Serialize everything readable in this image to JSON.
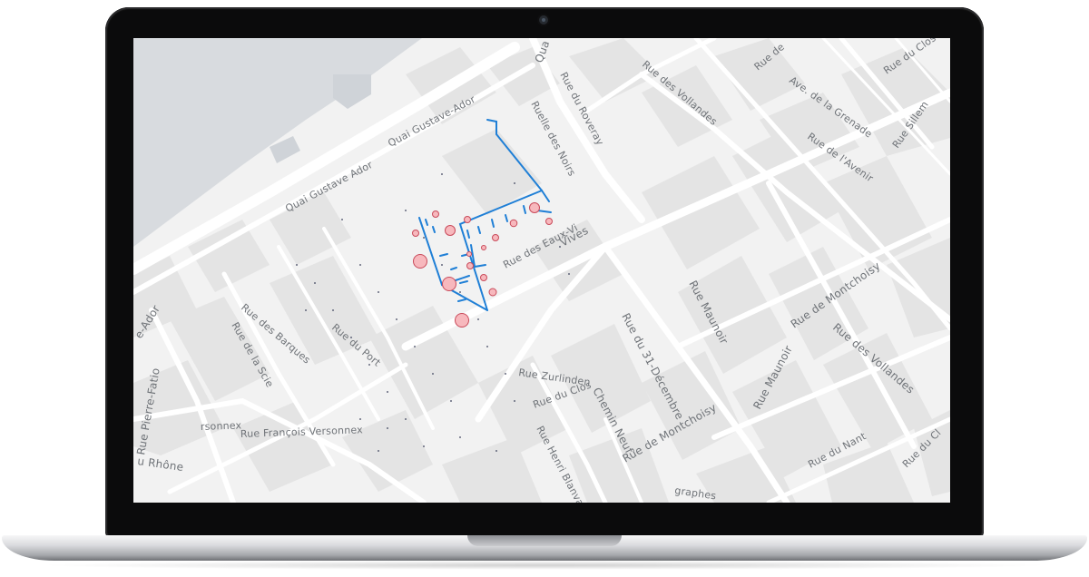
{
  "map": {
    "street_labels": [
      {
        "id": "quai-gustave-ador-1",
        "text": "Quai Gustave Ador"
      },
      {
        "id": "quai-gustave-ador-2",
        "text": "Quai Gustave-Ador"
      },
      {
        "id": "ador-edge",
        "text": "e-Ador"
      },
      {
        "id": "ruelle-des-noirs",
        "text": "Ruelle des Noirs"
      },
      {
        "id": "rue-du-roveray",
        "text": "Rue du Roveray"
      },
      {
        "id": "quai-top",
        "text": "Qua"
      },
      {
        "id": "rue-des-vollandes-top",
        "text": "Rue des Vollandes"
      },
      {
        "id": "rue-de-top",
        "text": "Rue de"
      },
      {
        "id": "ave-de-la-grenade",
        "text": "Ave. de la Grenade"
      },
      {
        "id": "rue-du-clos",
        "text": "Rue du Clos"
      },
      {
        "id": "rue-sillem",
        "text": "Rue Sillem"
      },
      {
        "id": "rue-de-lavenir",
        "text": "Rue de l'Avenir"
      },
      {
        "id": "vives",
        "text": "Vives"
      },
      {
        "id": "rue-des-eaux-vives",
        "text": "Rue des Eaux-Vi"
      },
      {
        "id": "rue-des-barques",
        "text": "Rue des Barques"
      },
      {
        "id": "rue-de-la-scie",
        "text": "Rue de la Scie"
      },
      {
        "id": "rue-du-port",
        "text": "Rue du Port"
      },
      {
        "id": "rue-pierre-fatio",
        "text": "Rue Pierre-Fatio"
      },
      {
        "id": "rue-maunoir-1",
        "text": "Rue Maunoir"
      },
      {
        "id": "rue-de-montchoisy-1",
        "text": "Rue de Montchoisy"
      },
      {
        "id": "rue-des-vollandes-2",
        "text": "Rue des Vollandes"
      },
      {
        "id": "rue-du-31-decembre",
        "text": "Rue du 31-Décembre"
      },
      {
        "id": "rue-maunoir-2",
        "text": "Rue Maunoir"
      },
      {
        "id": "rue-du-nant",
        "text": "Rue du Nant"
      },
      {
        "id": "rue-du-cl",
        "text": "Rue du Cl"
      },
      {
        "id": "chemin-neuf",
        "text": "Chemin Neuf"
      },
      {
        "id": "rue-de-montchoisy-2",
        "text": "Rue de Montchoisy"
      },
      {
        "id": "rue-francois-versonnex",
        "text": "Rue François Versonnex"
      },
      {
        "id": "versonnex-short",
        "text": "rsonnex"
      },
      {
        "id": "rue-du-rhone",
        "text": "u Rhône"
      },
      {
        "id": "graphes",
        "text": "graphes"
      },
      {
        "id": "rue-zurlinden",
        "text": "Rue Zurlinden"
      },
      {
        "id": "rue-henri-blanvalet",
        "text": "Rue Henri Blanvalet"
      },
      {
        "id": "rue-du-clos-2",
        "text": "Rue du Clos"
      }
    ],
    "colors": {
      "water": "#d8dbdf",
      "land": "#f2f2f2",
      "block": "#e4e4e4",
      "road": "#ffffff",
      "network": "#1f7fd6",
      "marker_fill": "#f7b8bd",
      "marker_stroke": "#c94a5a"
    },
    "markers": [
      {
        "id": "m1",
        "size": "small"
      },
      {
        "id": "m2",
        "size": "small"
      },
      {
        "id": "m3",
        "size": "medium"
      },
      {
        "id": "m4",
        "size": "small"
      },
      {
        "id": "m5",
        "size": "small"
      },
      {
        "id": "m6",
        "size": "medium"
      },
      {
        "id": "m7",
        "size": "small"
      },
      {
        "id": "m8",
        "size": "small"
      },
      {
        "id": "m9",
        "size": "tiny"
      },
      {
        "id": "m10",
        "size": "tiny"
      },
      {
        "id": "m11",
        "size": "large"
      },
      {
        "id": "m12",
        "size": "small"
      },
      {
        "id": "m13",
        "size": "large"
      },
      {
        "id": "m14",
        "size": "small"
      },
      {
        "id": "m15",
        "size": "small"
      },
      {
        "id": "m16",
        "size": "large"
      }
    ]
  }
}
